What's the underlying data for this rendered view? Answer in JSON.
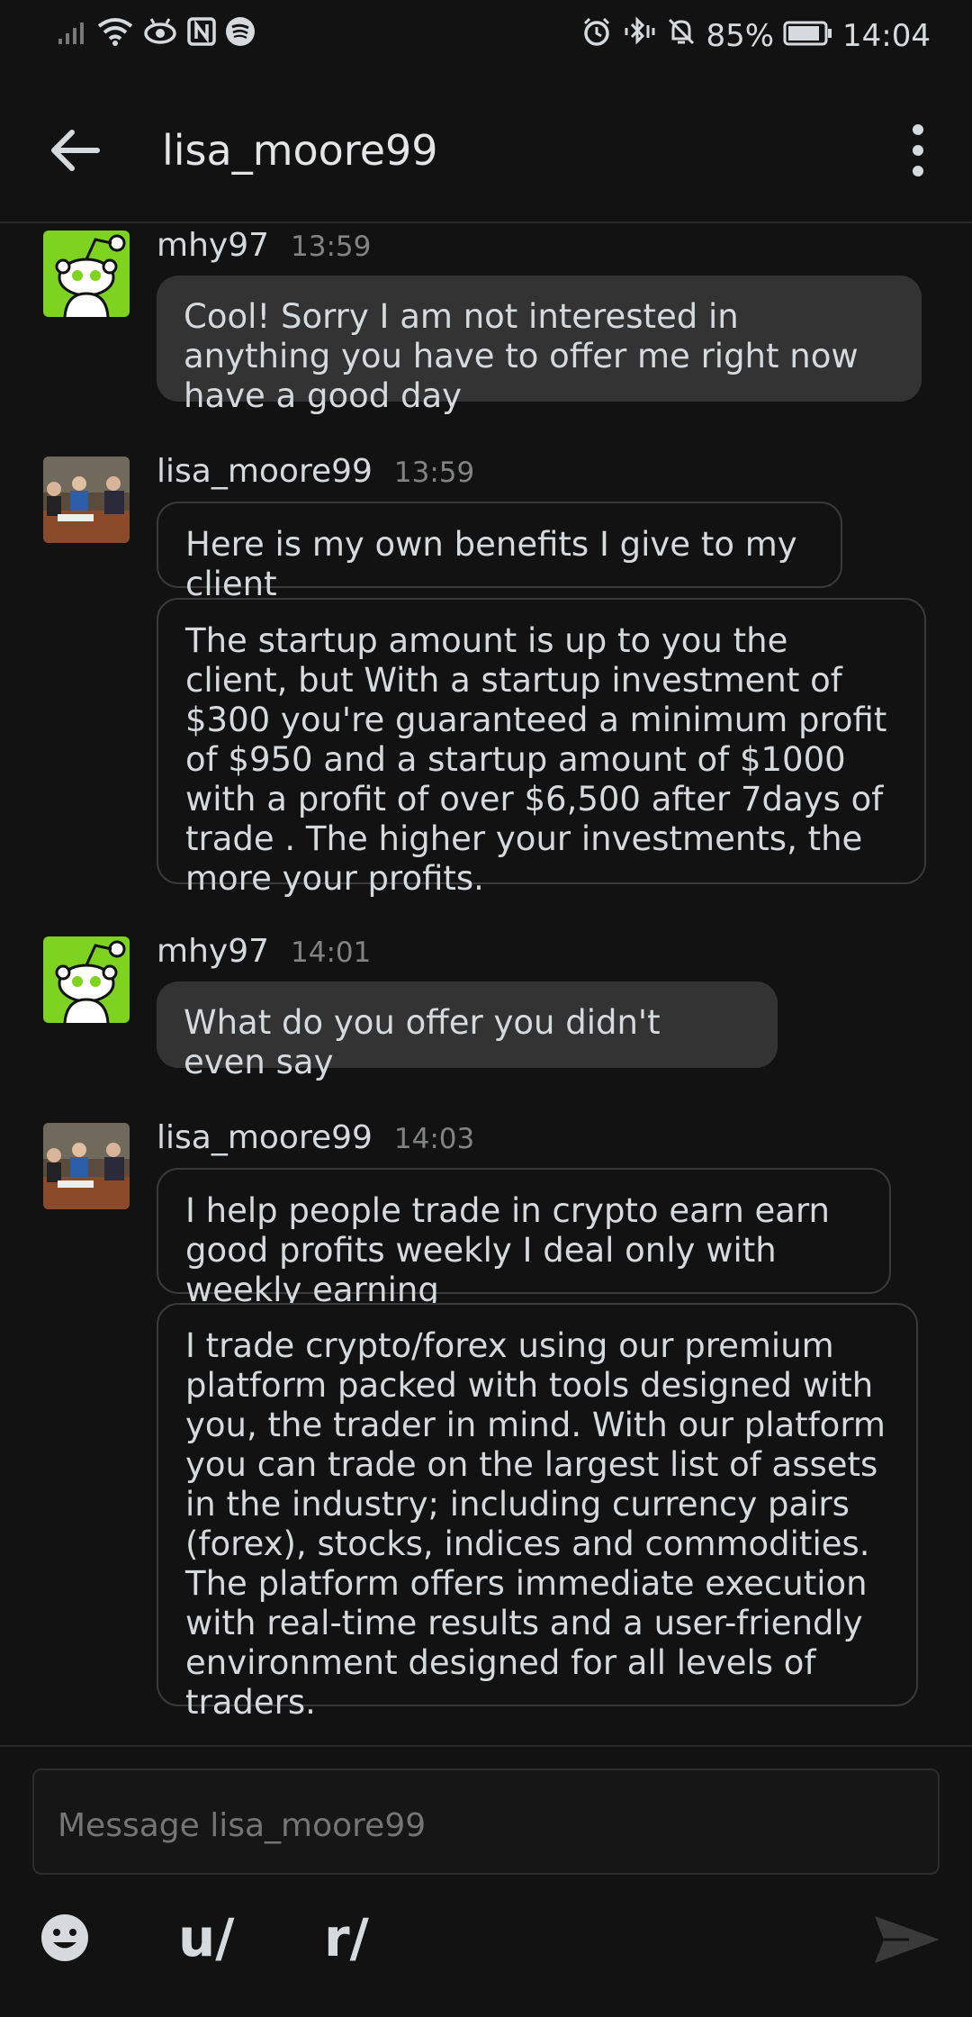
{
  "status_bar": {
    "battery": "85%",
    "time": "14:04"
  },
  "header": {
    "title": "lisa_moore99"
  },
  "messages": [
    {
      "author": "mhy97",
      "time": "13:59",
      "bubbles": [
        "Cool! Sorry I am not interested in anything you have to offer me right now have a good day"
      ]
    },
    {
      "author": "lisa_moore99",
      "time": "13:59",
      "bubbles": [
        "Here is my own benefits I give to my client",
        "The startup amount is up to you the client,  but With a startup investment of $300 you're guaranteed a minimum profit of $950 and a startup amount of $1000 with a profit of over $6,500 after 7days of trade . The higher your investments, the more your profits."
      ]
    },
    {
      "author": "mhy97",
      "time": "14:01",
      "bubbles": [
        "What do you offer you didn't even say"
      ]
    },
    {
      "author": "lisa_moore99",
      "time": "14:03",
      "bubbles": [
        "I help people trade in crypto earn earn good profits weekly I deal only with weekly earning",
        "I trade crypto/forex using our premium platform packed with tools designed with you, the trader in mind. With our platform you can trade on the largest list of assets in the industry; including currency pairs (forex), stocks, indices and commodities. The platform offers immediate execution with real-time results and a user-friendly environment designed for all levels of traders."
      ]
    }
  ],
  "composer": {
    "placeholder": "Message lisa_moore99",
    "user_mention_label": "u/",
    "community_mention_label": "r/"
  },
  "colors": {
    "background": "#121212",
    "bubble_filled": "#333333",
    "bubble_outline": "#3a3a3a",
    "avatar_green": "#7ed321"
  }
}
